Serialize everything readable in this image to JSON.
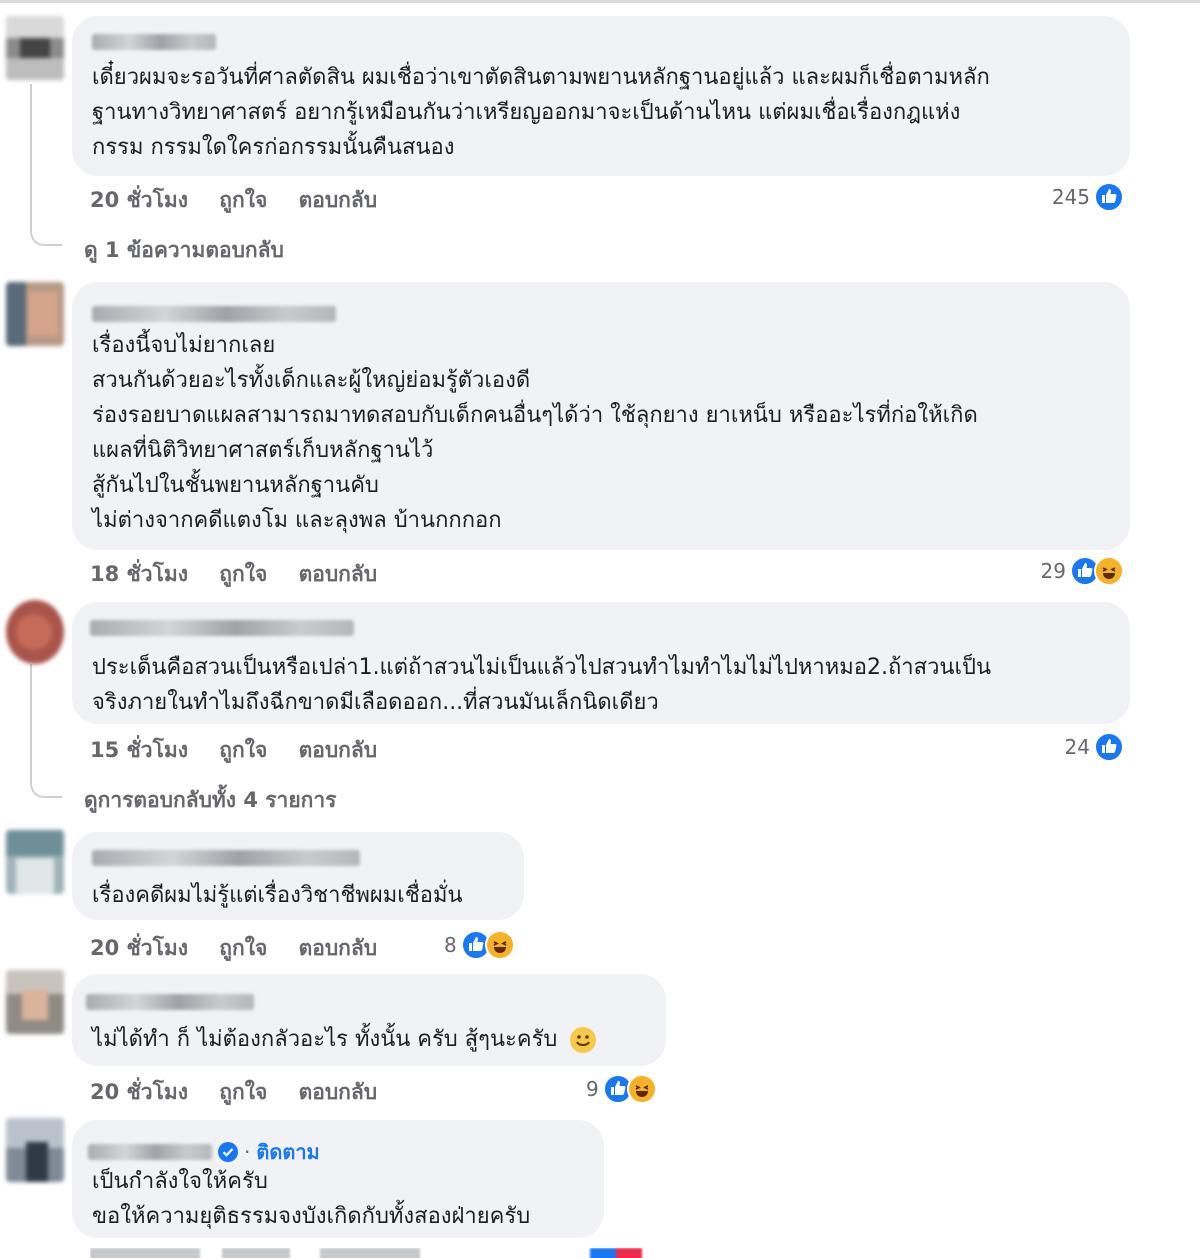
{
  "colors": {
    "bubble": "#f0f2f5",
    "meta": "#65676b",
    "like": "#1877f2",
    "haha": "#f7b125",
    "follow": "#1877f2"
  },
  "comments": [
    {
      "lines": [
        "เดี๋ยวผมจะรอวันที่ศาลตัดสิน ผมเชื่อว่าเขาตัดสินตามพยานหลักฐานอยู่แล้ว และผมก็เชื่อตามหลัก",
        "ฐานทางวิทยาศาสตร์ อยากรู้เหมือนกันว่าเหรียญออกมาจะเป็นด้านไหน แต่ผมเชื่อเรื่องกฎแห่ง",
        "กรรม กรรมใดใครก่อกรรมนั้นคืนสนอง"
      ],
      "time": "20 ชั่วโมง",
      "like": "ถูกใจ",
      "reply": "ตอบกลับ",
      "reaction_count": "245",
      "reaction_icons": [
        "like-icon"
      ],
      "view_replies": "ดู 1 ข้อความตอบกลับ"
    },
    {
      "lines": [
        "เรื่องนี้จบไม่ยากเลย",
        "สวนกันด้วยอะไรทั้งเด็กและผู้ใหญ่ย่อมรู้ตัวเองดี",
        "ร่องรอยบาดแผลสามารถมาทดสอบกับเด็กคนอื่นๆได้ว่า ใช้ลุกยาง ยาเหน็บ หรืออะไรที่ก่อให้เกิด",
        "แผลที่นิติวิทยาศาสตร์เก็บหลักฐานไว้",
        "สู้กันไปในชั้นพยานหลักฐานคับ",
        "ไม่ต่างจากคดีแตงโม และลุงพล บ้านกกกอก"
      ],
      "time": "18 ชั่วโมง",
      "like": "ถูกใจ",
      "reply": "ตอบกลับ",
      "reaction_count": "29",
      "reaction_icons": [
        "like-icon",
        "haha-icon"
      ]
    },
    {
      "lines": [
        "ประเด็นคือสวนเป็นหรือเปล่า1.แต่ถ้าสวนไม่เป็นแล้วไปสวนทำไมทำไมไม่ไปหาหมอ2.ถ้าสวนเป็น",
        "จริงภายในทำไมถึงฉีกขาดมีเลือดออก...ที่สวนมันเล็กนิดเดียว"
      ],
      "time": "15 ชั่วโมง",
      "like": "ถูกใจ",
      "reply": "ตอบกลับ",
      "reaction_count": "24",
      "reaction_icons": [
        "like-icon"
      ],
      "view_replies": "ดูการตอบกลับทั้ง 4 รายการ"
    },
    {
      "lines": [
        "เรื่องคดีผมไม่รู้แต่เรื่องวิชาชีพผมเชื่อมั่น"
      ],
      "time": "20 ชั่วโมง",
      "like": "ถูกใจ",
      "reply": "ตอบกลับ",
      "reaction_count": "8",
      "reaction_icons": [
        "like-icon",
        "haha-icon"
      ]
    },
    {
      "lines": [
        "ไม่ได้ทำ ก็ ไม่ต้องกลัวอะไร ทั้งนั้น ครับ สู้ๆนะครับ"
      ],
      "emoji": "smiling-face-emoji",
      "time": "20 ชั่วโมง",
      "like": "ถูกใจ",
      "reply": "ตอบกลับ",
      "reaction_count": "9",
      "reaction_icons": [
        "like-icon",
        "haha-icon"
      ]
    },
    {
      "follow": "ติดตาม",
      "verified": true,
      "lines": [
        "เป็นกำลังใจให้ครับ",
        "ขอให้ความยุติธรรมจงบังเกิดกับทั้งสองฝ่ายครับ"
      ]
    }
  ]
}
